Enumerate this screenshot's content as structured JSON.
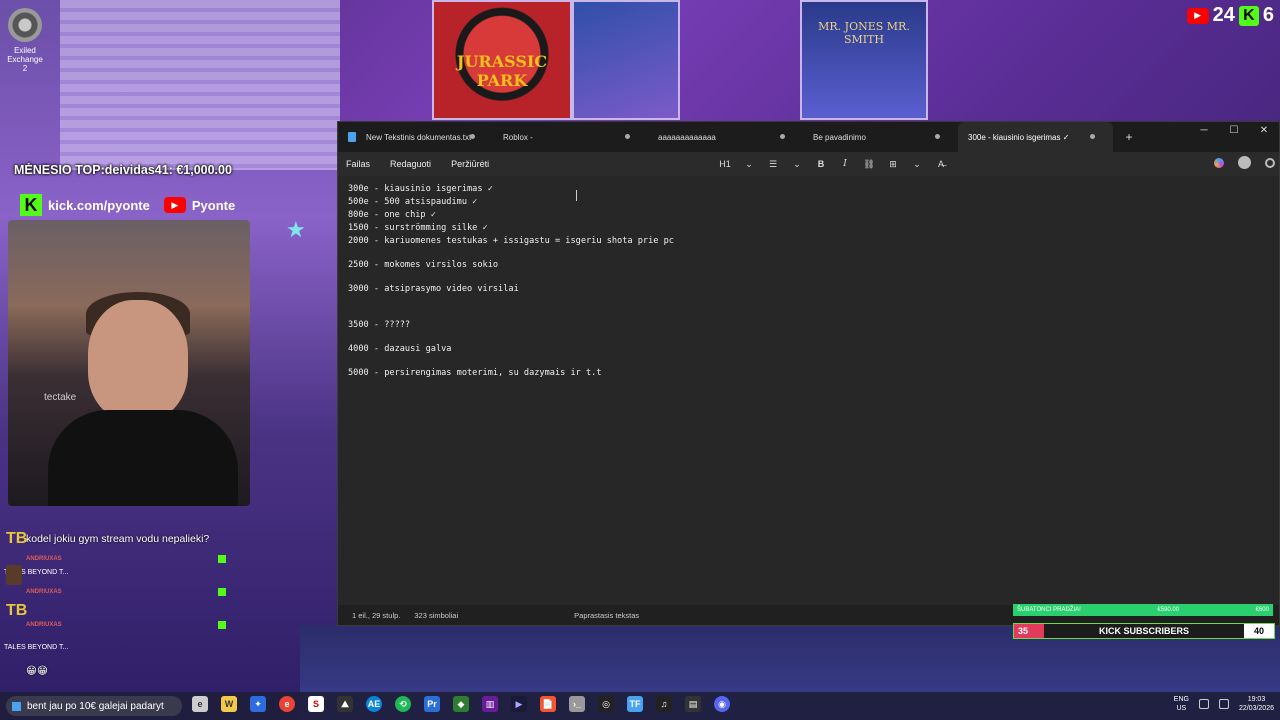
{
  "desktop": {
    "icon_label": "Exiled Exchange 2"
  },
  "counters": {
    "youtube_count": "24",
    "kick_letter": "K",
    "kick_count": "6"
  },
  "overlay": {
    "top_donor": "MĖNESIO TOP:deividas41: €1,000.00",
    "kick_url": "kick.com/pyonte",
    "youtube_name": "Pyonte",
    "chair_brand": "tectake",
    "poster_jp": "JURASSIC PARK",
    "poster_mib": "MR. JONES MR. SMITH"
  },
  "chat": {
    "message": "kodel jokiu gym stream vodu nepalieki?",
    "names": [
      "ANDRIUXAS",
      "ANDRIUXAS",
      "ANDRIUXAS"
    ],
    "tales_1": "TALES BEYOND T...",
    "tales_2": "TALES BEYOND T...",
    "emojis": "😁😁"
  },
  "notepad": {
    "tabs": [
      {
        "label": "New Tekstinis dokumentas.txt",
        "active": false
      },
      {
        "label": "Roblox -",
        "active": false
      },
      {
        "label": "aaaaaaaaaaaaa",
        "active": false
      },
      {
        "label": "Be pavadinimo",
        "active": false
      },
      {
        "label": "300e - kiausinio isgerimas ✓",
        "active": true
      }
    ],
    "add_tab": "+",
    "window_controls": {
      "minimize": "─",
      "maximize": "☐",
      "close": "✕"
    },
    "menu": [
      "Failas",
      "Redaguoti",
      "Peržiūrėti"
    ],
    "toolbar": {
      "heading": "H1",
      "list": "☰",
      "bold": "B",
      "italic": "I",
      "link": "⛓",
      "table": "⊞",
      "clear": "A̶"
    },
    "lines": [
      "300e - kiausinio isgerimas ✓",
      "500e - 500 atsispaudimu ✓",
      "800e - one chip ✓",
      "1500 - surströmming silke ✓",
      "2000 - kariuomenes testukas + issigastu = isgeriu shota prie pc",
      "",
      "2500 - mokomes virsilos sokio",
      "",
      "3000 - atsiprasymo video virsilai",
      "",
      "",
      "",
      "3500 - ?????",
      "",
      "4000 - dazausi galva",
      "",
      "5000 - persirengimas moterimi, su dazymais ir t.t"
    ],
    "status": {
      "position": "1 eil., 29 stulp.",
      "chars": "323 simboliai",
      "format": "Paprastasis tekstas"
    }
  },
  "goal": {
    "mini_left": "ŠUBATONCI PRADŽIA!",
    "mini_mid": "€590.00",
    "mini_right": "€600",
    "subs_current": "35",
    "subs_label": "KICK SUBSCRIBERS",
    "subs_target": "40"
  },
  "taskbar": {
    "search_text": "bent jau po 10€ galejai padaryt",
    "apps": [
      "e",
      "W",
      "✦",
      "e",
      "S",
      "⛰",
      "AE",
      "⟲",
      "Pr",
      "◆",
      "▥",
      "▶",
      "📄",
      "›_",
      "◎",
      "TF",
      "♫",
      "▤",
      "◉"
    ],
    "lang_1": "ENG",
    "lang_2": "US",
    "time": "19:03",
    "date": "22/03/2026"
  },
  "colors": {
    "kick_green": "#53fc18",
    "youtube_red": "#ff0000",
    "notepad_bg": "#272727",
    "subs_red": "#e23a5a"
  }
}
